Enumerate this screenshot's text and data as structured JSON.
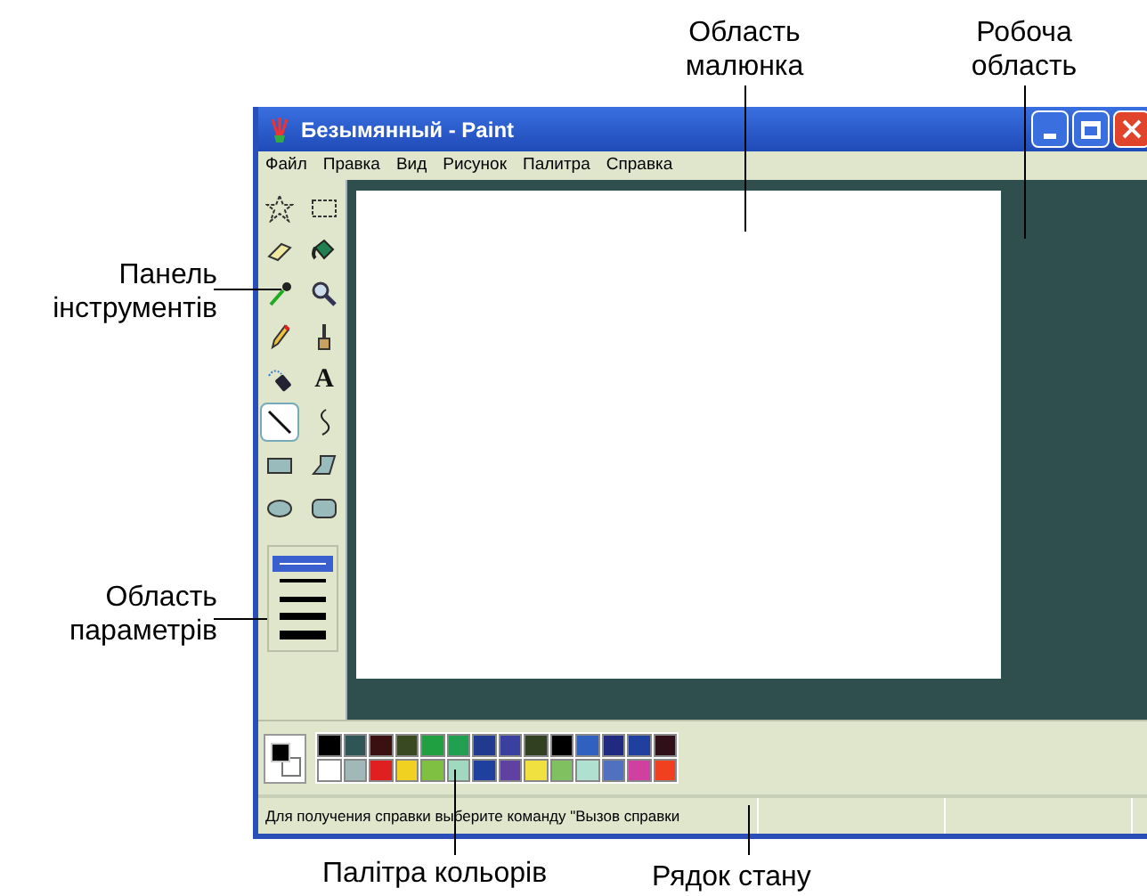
{
  "window": {
    "title": "Безымянный - Paint"
  },
  "menu": [
    "Файл",
    "Правка",
    "Вид",
    "Рисунок",
    "Палитра",
    "Справка"
  ],
  "tools": [
    {
      "kind": "free-select",
      "selected": false
    },
    {
      "kind": "select",
      "selected": false
    },
    {
      "kind": "eraser",
      "selected": false
    },
    {
      "kind": "fill",
      "selected": false
    },
    {
      "kind": "picker",
      "selected": false
    },
    {
      "kind": "magnifier",
      "selected": false
    },
    {
      "kind": "pencil",
      "selected": false
    },
    {
      "kind": "brush",
      "selected": false
    },
    {
      "kind": "airbrush",
      "selected": false
    },
    {
      "kind": "text",
      "glyph": "A",
      "selected": false
    },
    {
      "kind": "line",
      "selected": true
    },
    {
      "kind": "curve",
      "selected": false
    },
    {
      "kind": "rectangle",
      "selected": false
    },
    {
      "kind": "polygon",
      "selected": false
    },
    {
      "kind": "ellipse",
      "selected": false
    },
    {
      "kind": "rounded-rectangle",
      "selected": false
    }
  ],
  "line_widths": [
    {
      "selected": true
    },
    {
      "selected": false
    },
    {
      "selected": false
    },
    {
      "selected": false
    },
    {
      "selected": false
    }
  ],
  "palette": {
    "foreground": {
      "color": "#000000"
    },
    "background": {
      "color": "#ffffff"
    },
    "colors": [
      {
        "color": "#000000"
      },
      {
        "color": "#2f5557"
      },
      {
        "color": "#3a1010"
      },
      {
        "color": "#3a4a20"
      },
      {
        "color": "#20a040"
      },
      {
        "color": "#20a050"
      },
      {
        "color": "#203a90"
      },
      {
        "color": "#3a40a0"
      },
      {
        "color": "#304020"
      },
      {
        "color": "#000000"
      },
      {
        "color": "#3060c0"
      },
      {
        "color": "#202a80"
      },
      {
        "color": "#2040a0"
      },
      {
        "color": "#301018"
      },
      {
        "color": "#ffffff"
      },
      {
        "color": "#a0b8b8"
      },
      {
        "color": "#e02020"
      },
      {
        "color": "#f0d020"
      },
      {
        "color": "#80c040"
      },
      {
        "color": "#a0d8c0"
      },
      {
        "color": "#2040a0"
      },
      {
        "color": "#6040a0"
      },
      {
        "color": "#f0e040"
      },
      {
        "color": "#80c060"
      },
      {
        "color": "#b0e0d0"
      },
      {
        "color": "#5070c0"
      },
      {
        "color": "#d040a0"
      },
      {
        "color": "#f04020"
      }
    ]
  },
  "status_bar": {
    "text": "Для получения справки выберите команду \"Вызов справки"
  },
  "callouts": {
    "drawing_area": [
      "Область",
      "малюнка"
    ],
    "work_area": [
      "Робоча",
      "область"
    ],
    "toolbox": [
      "Панель",
      "інструментів"
    ],
    "options": [
      "Область",
      "параметрів"
    ],
    "palette": "Палітра кольорів",
    "status_bar": "Рядок стану"
  }
}
